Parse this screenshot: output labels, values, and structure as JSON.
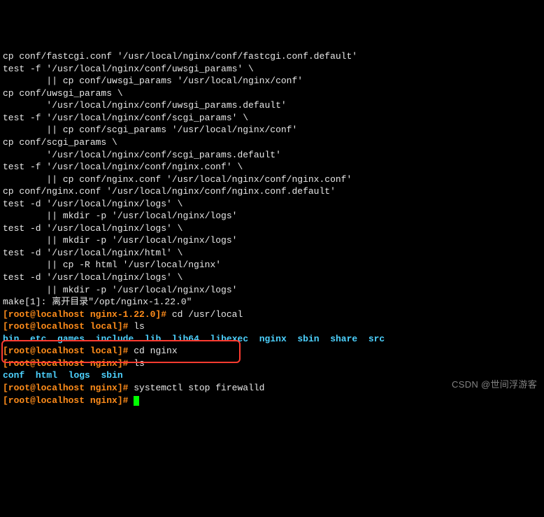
{
  "output": [
    "cp conf/fastcgi.conf '/usr/local/nginx/conf/fastcgi.conf.default'",
    "test -f '/usr/local/nginx/conf/uwsgi_params' \\",
    "        || cp conf/uwsgi_params '/usr/local/nginx/conf'",
    "cp conf/uwsgi_params \\",
    "        '/usr/local/nginx/conf/uwsgi_params.default'",
    "test -f '/usr/local/nginx/conf/scgi_params' \\",
    "        || cp conf/scgi_params '/usr/local/nginx/conf'",
    "cp conf/scgi_params \\",
    "        '/usr/local/nginx/conf/scgi_params.default'",
    "test -f '/usr/local/nginx/conf/nginx.conf' \\",
    "        || cp conf/nginx.conf '/usr/local/nginx/conf/nginx.conf'",
    "cp conf/nginx.conf '/usr/local/nginx/conf/nginx.conf.default'",
    "test -d '/usr/local/nginx/logs' \\",
    "        || mkdir -p '/usr/local/nginx/logs'",
    "test -d '/usr/local/nginx/logs' \\",
    "        || mkdir -p '/usr/local/nginx/logs'",
    "test -d '/usr/local/nginx/html' \\",
    "        || cp -R html '/usr/local/nginx'",
    "test -d '/usr/local/nginx/logs' \\",
    "        || mkdir -p '/usr/local/nginx/logs'",
    "make[1]: 离开目录\"/opt/nginx-1.22.0\""
  ],
  "prompts": {
    "p1_user": "[root@localhost nginx-1.22.0]#",
    "p1_cmd": " cd /usr/local",
    "p2_user": "[root@localhost local]#",
    "p2_cmd": " ls",
    "ls_local": [
      "bin",
      "etc",
      "games",
      "include",
      "lib",
      "lib64",
      "libexec",
      "nginx",
      "sbin",
      "share",
      "src"
    ],
    "ls_local_sep": "  ",
    "p3_user": "[root@localhost local]#",
    "p3_cmd": " cd nginx",
    "p4_user": "[root@localhost nginx]#",
    "p4_cmd": " ls",
    "ls_nginx": [
      "conf",
      "html",
      "logs",
      "sbin"
    ],
    "ls_nginx_sep": "  ",
    "p5_user": "[root@localhost nginx]#",
    "p5_cmd": " systemctl stop firewalld",
    "p6_user": "[root@localhost nginx]#",
    "p6_cmd": " "
  },
  "watermark": "CSDN @世间浮游客"
}
